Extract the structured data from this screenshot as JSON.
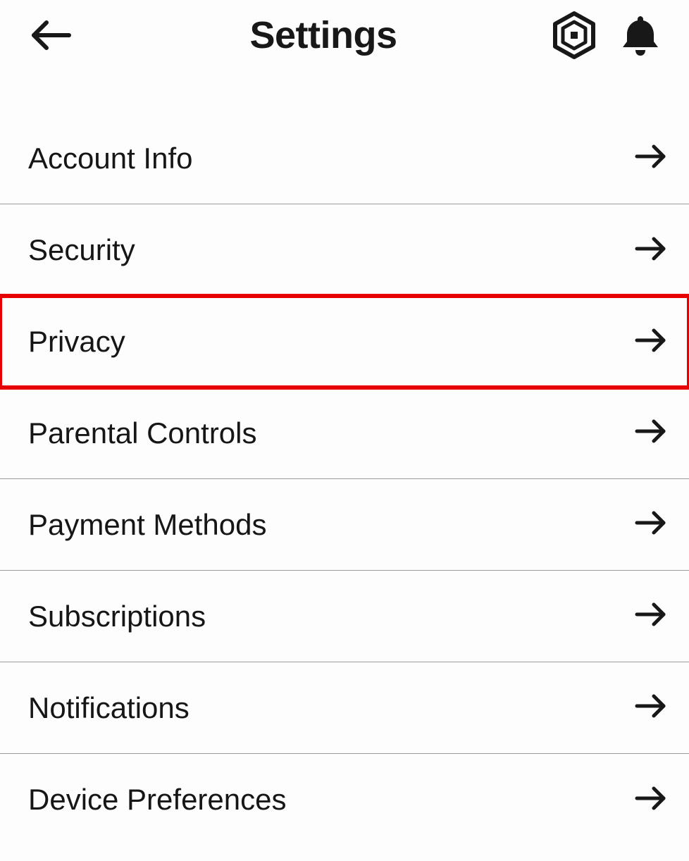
{
  "header": {
    "title": "Settings"
  },
  "menu": {
    "items": [
      {
        "label": "Account Info",
        "highlighted": false
      },
      {
        "label": "Security",
        "highlighted": false
      },
      {
        "label": "Privacy",
        "highlighted": true
      },
      {
        "label": "Parental Controls",
        "highlighted": false
      },
      {
        "label": "Payment Methods",
        "highlighted": false
      },
      {
        "label": "Subscriptions",
        "highlighted": false
      },
      {
        "label": "Notifications",
        "highlighted": false
      },
      {
        "label": "Device Preferences",
        "highlighted": false
      }
    ]
  },
  "colors": {
    "highlight": "#e60000"
  }
}
